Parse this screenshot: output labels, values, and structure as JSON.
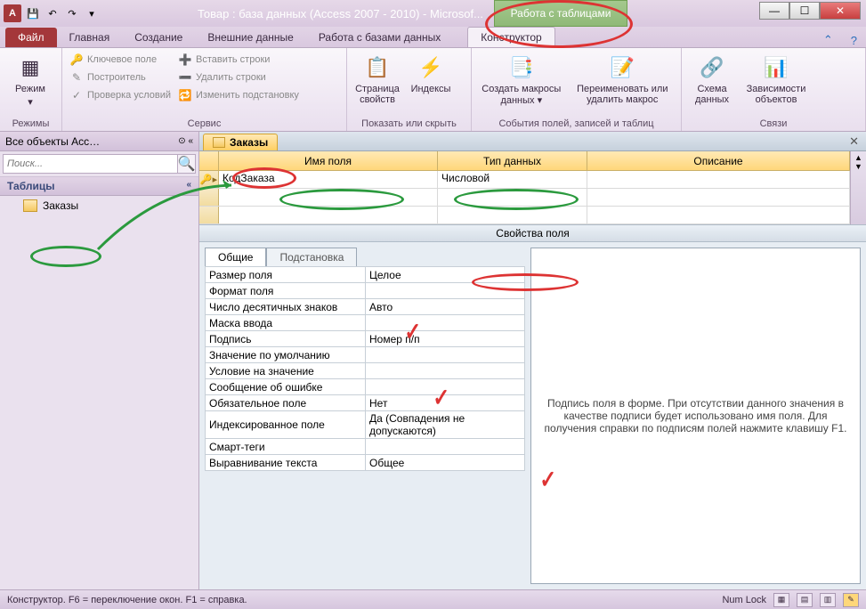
{
  "titlebar": {
    "app_letter": "A",
    "title": "Товар : база данных (Access 2007 - 2010) - Microsof...",
    "context_group": "Работа с таблицами"
  },
  "ribbon_tabs": {
    "file": "Файл",
    "home": "Главная",
    "create": "Создание",
    "external": "Внешние данные",
    "dbtools": "Работа с базами данных",
    "design": "Конструктор"
  },
  "ribbon": {
    "views": {
      "btn": "Режим",
      "group": "Режимы"
    },
    "tools": {
      "pk": "Ключевое поле",
      "builder": "Построитель",
      "test": "Проверка условий",
      "ins": "Вставить строки",
      "del": "Удалить строки",
      "mod": "Изменить подстановку",
      "group": "Сервис"
    },
    "showhide": {
      "props": "Страница свойств",
      "idx": "Индексы",
      "group": "Показать или скрыть"
    },
    "events": {
      "macros": "Создать макросы данных ▾",
      "rename": "Переименовать или удалить макрос",
      "group": "События полей, записей и таблиц"
    },
    "rel": {
      "schema": "Схема данных",
      "deps": "Зависимости объектов",
      "group": "Связи"
    }
  },
  "nav": {
    "header": "Все объекты Acc…",
    "search_placeholder": "Поиск...",
    "group": "Таблицы",
    "item1": "Заказы"
  },
  "doc": {
    "tab": "Заказы",
    "col_name": "Имя поля",
    "col_type": "Тип данных",
    "col_desc": "Описание",
    "row1_name": "КодЗаказа",
    "row1_type": "Числовой",
    "props_title": "Свойства поля",
    "tab_general": "Общие",
    "tab_lookup": "Подстановка",
    "props": [
      {
        "k": "Размер поля",
        "v": "Целое"
      },
      {
        "k": "Формат поля",
        "v": ""
      },
      {
        "k": "Число десятичных знаков",
        "v": "Авто"
      },
      {
        "k": "Маска ввода",
        "v": ""
      },
      {
        "k": "Подпись",
        "v": "Номер п/п"
      },
      {
        "k": "Значение по умолчанию",
        "v": ""
      },
      {
        "k": "Условие на значение",
        "v": ""
      },
      {
        "k": "Сообщение об ошибке",
        "v": ""
      },
      {
        "k": "Обязательное поле",
        "v": "Нет"
      },
      {
        "k": "Индексированное поле",
        "v": "Да (Совпадения не допускаются)"
      },
      {
        "k": "Смарт-теги",
        "v": ""
      },
      {
        "k": "Выравнивание текста",
        "v": "Общее"
      }
    ],
    "hint": "Подпись поля в форме. При отсутствии данного значения в качестве подписи будет использовано имя поля. Для получения справки по подписям полей нажмите клавишу F1."
  },
  "status": {
    "left": "Конструктор.  F6 = переключение окон.  F1 = справка.",
    "numlock": "Num Lock"
  }
}
